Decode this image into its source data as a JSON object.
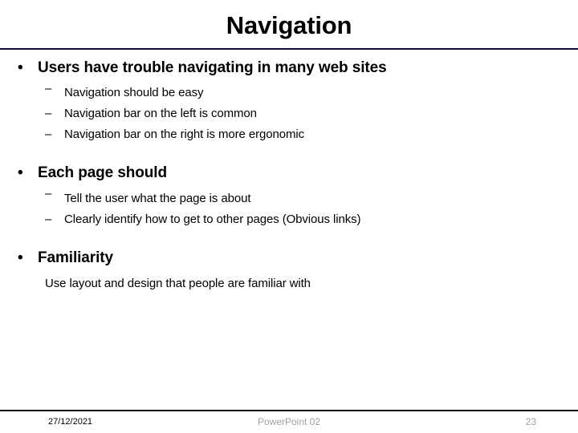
{
  "slide": {
    "title": "Navigation",
    "title_rule_color": "#0A0A3C",
    "footer_rule_color": "#000000",
    "background_color": "#FFFFFF",
    "text_color": "#000000",
    "footer_muted_color": "#A0A0A0"
  },
  "content": {
    "sections": [
      {
        "heading": "Users have trouble navigating in many web sites",
        "heading_marker": "•",
        "sub_items": [
          {
            "marker": "–",
            "text": "Navigation should be easy"
          },
          {
            "marker": "–",
            "text": "Navigation bar on the left is common"
          },
          {
            "marker": "–",
            "text": "Navigation bar on the right is more ergonomic"
          }
        ]
      },
      {
        "heading": "Each page should",
        "heading_marker": "•",
        "sub_items": [
          {
            "marker": "–",
            "text": "Tell the user what the page is about"
          },
          {
            "marker": "–",
            "text": "Clearly identify how to get to other pages (Obvious links)"
          }
        ]
      },
      {
        "heading": "Familiarity",
        "heading_marker": "•",
        "sub_items": [
          {
            "marker": "",
            "text": "Use layout and design that people are familiar with"
          }
        ]
      }
    ]
  },
  "footer": {
    "date": "27/12/2021",
    "center_label": "PowerPoint 02",
    "page_number": "23"
  }
}
